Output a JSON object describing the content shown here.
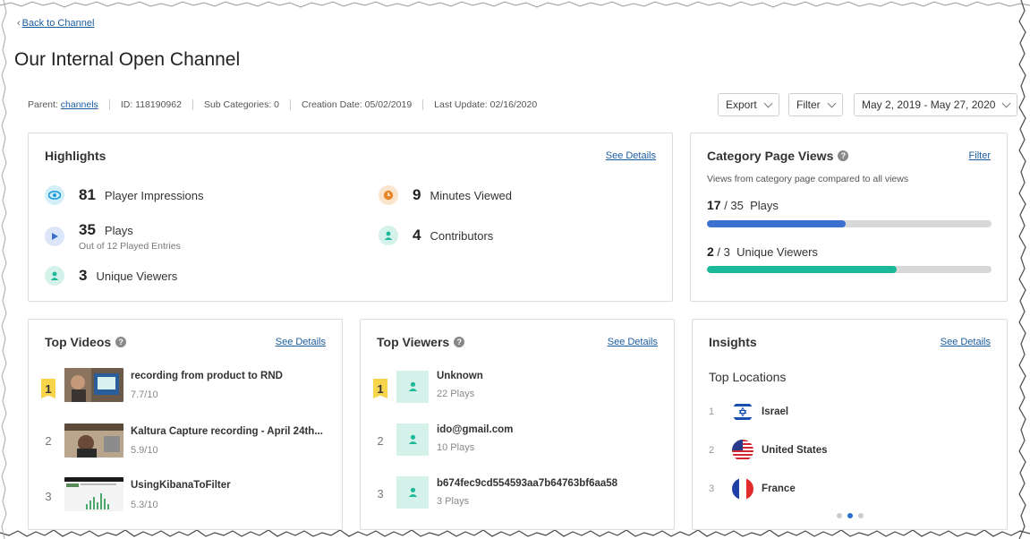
{
  "nav": {
    "back_label": "Back to Channel"
  },
  "page": {
    "title": "Our Internal Open Channel"
  },
  "meta": {
    "parent_label": "Parent:",
    "parent_value": "channels",
    "id_text": "ID: 118190962",
    "sub_categories_text": "Sub Categories: 0",
    "creation_date_text": "Creation Date: 05/02/2019",
    "last_update_text": "Last Update: 02/16/2020"
  },
  "controls": {
    "export_label": "Export",
    "filter_label": "Filter",
    "date_range": "May 2, 2019 - May 27, 2020"
  },
  "highlights": {
    "title": "Highlights",
    "see_details": "See Details",
    "items": [
      {
        "value": "81",
        "label": "Player Impressions",
        "icon": "eye-icon",
        "color": "#1a9bd7"
      },
      {
        "value": "35",
        "label": "Plays",
        "sub": "Out of 12 Played Entries",
        "icon": "play-icon",
        "color": "#3b6fd0"
      },
      {
        "value": "3",
        "label": "Unique Viewers",
        "icon": "user-icon",
        "color": "#1bb89a"
      },
      {
        "value": "9",
        "label": "Minutes Viewed",
        "icon": "clock-icon",
        "color": "#e8862a"
      },
      {
        "value": "4",
        "label": "Contributors",
        "icon": "user-icon",
        "color": "#1bb89a"
      }
    ]
  },
  "category_page_views": {
    "title": "Category Page Views",
    "filter_label": "Filter",
    "subtitle": "Views from category page compared to all views",
    "plays": {
      "count": "17",
      "total": "35",
      "label": "Plays",
      "fraction": 0.486,
      "color": "#3b6fd0"
    },
    "viewers": {
      "count": "2",
      "total": "3",
      "label": "Unique Viewers",
      "fraction": 0.667,
      "color": "#1bb89a"
    }
  },
  "top_videos": {
    "title": "Top Videos",
    "see_details": "See Details",
    "items": [
      {
        "rank": "1",
        "title": "recording from product to RND",
        "score": "7.7/10"
      },
      {
        "rank": "2",
        "title": "Kaltura Capture recording - April 24th...",
        "score": "5.9/10"
      },
      {
        "rank": "3",
        "title": "UsingKibanaToFilter",
        "score": "5.3/10"
      }
    ]
  },
  "top_viewers": {
    "title": "Top Viewers",
    "see_details": "See Details",
    "items": [
      {
        "rank": "1",
        "name": "Unknown",
        "plays": "22 Plays"
      },
      {
        "rank": "2",
        "name": "ido@gmail.com",
        "plays": "10 Plays"
      },
      {
        "rank": "3",
        "name": "b674fec9cd554593aa7b64763bf6aa58",
        "plays": "3 Plays"
      }
    ]
  },
  "insights": {
    "title": "Insights",
    "see_details": "See Details",
    "subtitle": "Top Locations",
    "locations": [
      {
        "rank": "1",
        "name": "Israel",
        "flag": "israel-flag-icon"
      },
      {
        "rank": "2",
        "name": "United States",
        "flag": "usa-flag-icon"
      },
      {
        "rank": "3",
        "name": "France",
        "flag": "france-flag-icon"
      }
    ],
    "pager_active_index": 1
  }
}
